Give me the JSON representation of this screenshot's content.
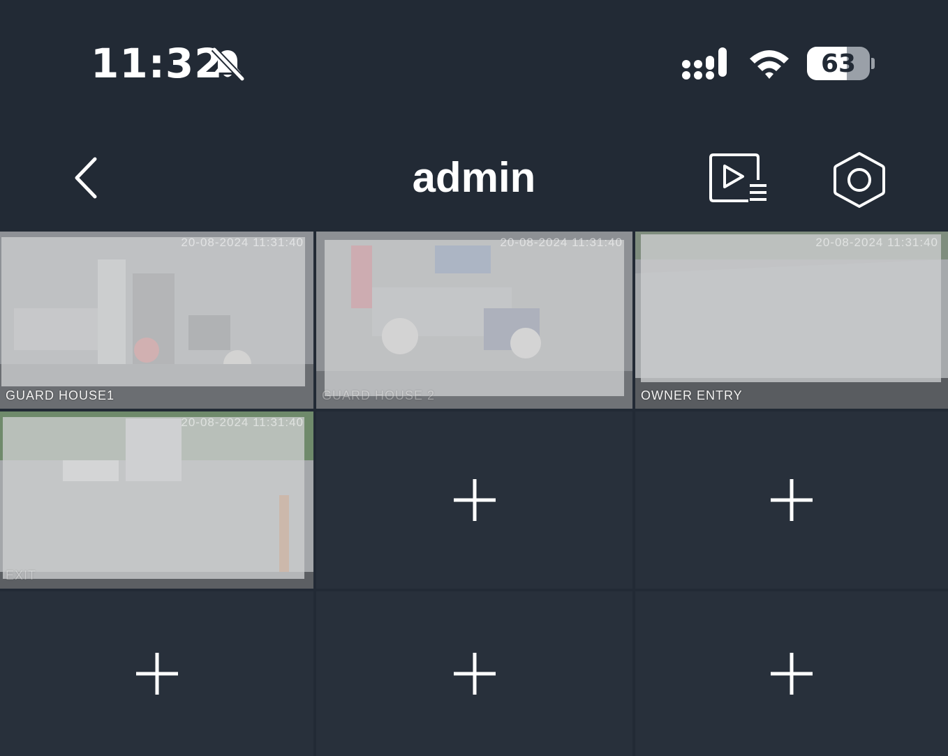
{
  "status_bar": {
    "time": "11:32",
    "battery_percent": 63,
    "battery_text": "63",
    "icons": [
      "bell-slash-icon",
      "cellular-signal-icon",
      "wifi-icon",
      "battery-icon"
    ]
  },
  "nav": {
    "title": "admin",
    "icons": [
      "back-chevron-icon",
      "playback-list-icon",
      "settings-hexagon-icon"
    ]
  },
  "colors": {
    "background": "#222a35",
    "cell_background": "#28303b",
    "selected_border": "#2d7fe0"
  },
  "cameras": [
    {
      "label": "GUARD HOUSE1",
      "timestamp": "20-08-2024 11:31:40",
      "selected": true
    },
    {
      "label": "GUARD HOUSE 2",
      "timestamp": "20-08-2024 11:31:40",
      "selected": false
    },
    {
      "label": "OWNER ENTRY",
      "timestamp": "20-08-2024 11:31:40",
      "selected": false
    },
    {
      "label": "EXIT",
      "timestamp": "20-08-2024 11:31:40",
      "selected": false
    }
  ],
  "empty_slots": [
    {
      "icon": "plus-icon"
    },
    {
      "icon": "plus-icon"
    },
    {
      "icon": "plus-icon"
    },
    {
      "icon": "plus-icon"
    },
    {
      "icon": "plus-icon"
    }
  ]
}
